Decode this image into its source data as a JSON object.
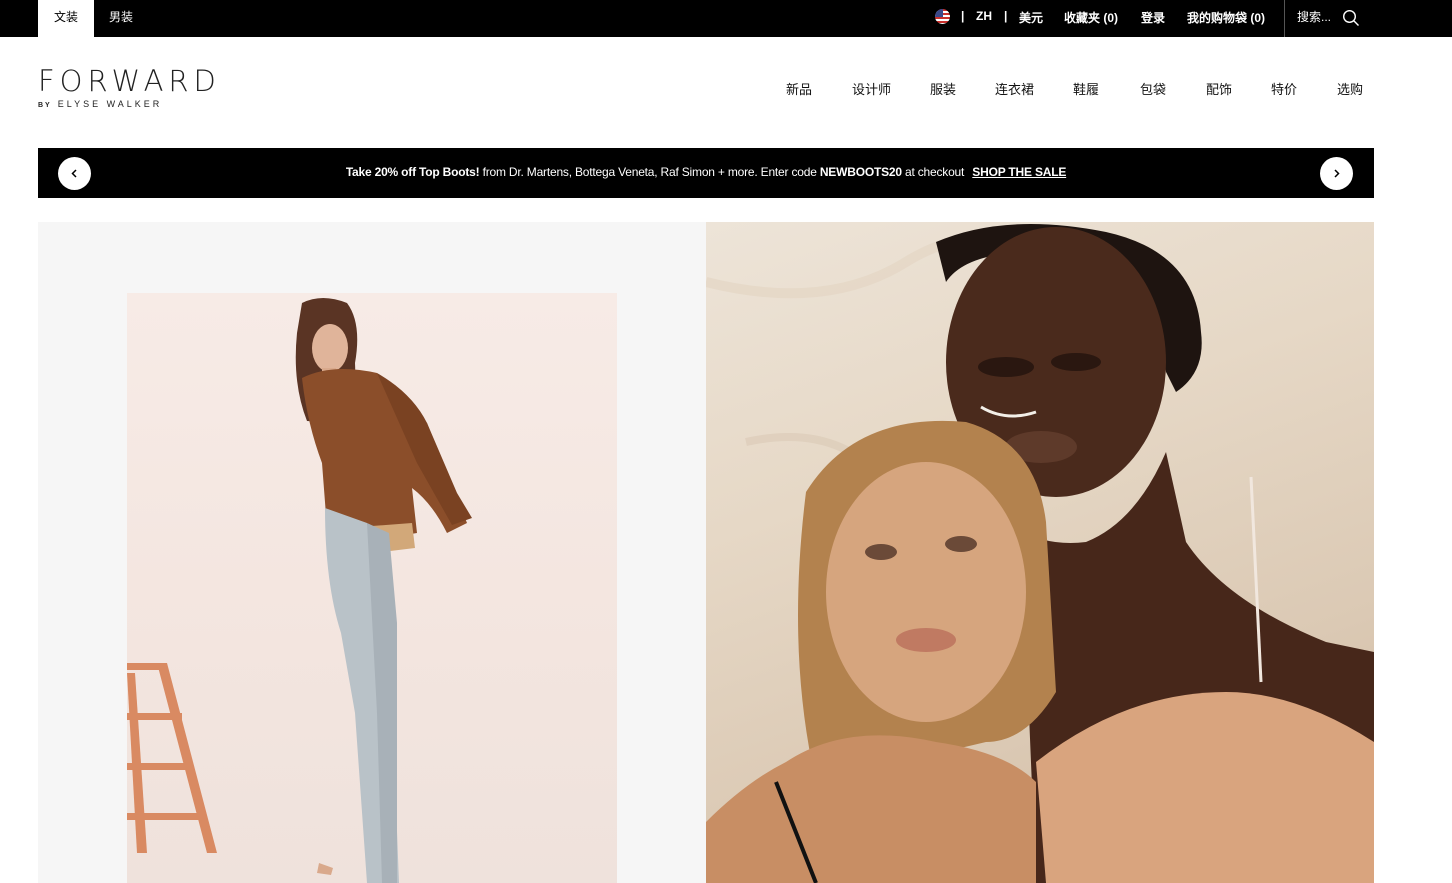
{
  "topbar": {
    "tabs": [
      {
        "label": "文装",
        "active": true
      },
      {
        "label": "男装",
        "active": false
      }
    ],
    "language": "ZH",
    "currency": "美元",
    "favorites": "收藏夹 (0)",
    "login": "登录",
    "cart": "我的购物袋 (0)",
    "search_placeholder": "搜索..."
  },
  "logo": {
    "main": "FORWARD",
    "by": "BY",
    "sub": "ELYSE WALKER"
  },
  "nav": [
    "新品",
    "设计师",
    "服装",
    "连衣裙",
    "鞋履",
    "包袋",
    "配饰",
    "特价",
    "选购"
  ],
  "promo": {
    "bold": "Take 20% off Top Boots!",
    "text1": " from Dr. Martens, Bottega Veneta, Raf Simon + more. Enter code ",
    "code": "NEWBOOTS20",
    "text2": " at checkout",
    "link": "SHOP THE SALE"
  },
  "colors": {
    "topbar_bg": "#000000",
    "promo_bg": "#000000",
    "hero_left_bg": "#f6f6f6"
  },
  "icons": [
    "flag-us-icon",
    "search-icon",
    "chevron-left-icon",
    "chevron-right-icon"
  ]
}
